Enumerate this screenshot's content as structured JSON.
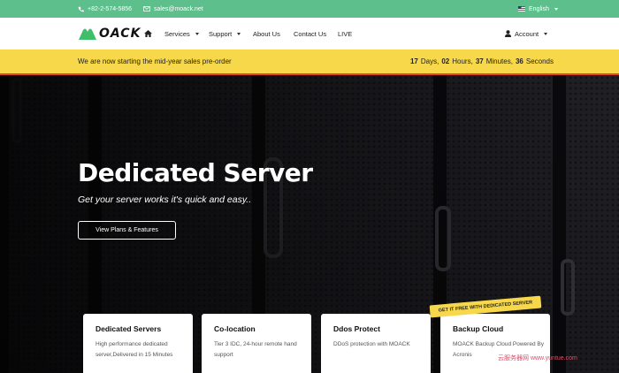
{
  "topbar": {
    "phone": "+82-2-574-5856",
    "email": "sales@moack.net",
    "language": "English"
  },
  "navbar": {
    "logo_text": "OACK",
    "items": [
      "Services",
      "Support",
      "About Us",
      "Contact Us",
      "LIVE"
    ],
    "account": "Account"
  },
  "promo": {
    "text": "We are now starting the mid-year sales pre-order",
    "countdown": {
      "days_value": "17",
      "days_label": "Days,",
      "hours_value": "02",
      "hours_label": "Hours,",
      "minutes_value": "37",
      "minutes_label": "Minutes,",
      "seconds_value": "36",
      "seconds_label": "Seconds"
    }
  },
  "hero": {
    "title": "Dedicated Server",
    "subtitle": "Get your server works it's quick and easy..",
    "button": "View Plans & Features"
  },
  "cards": [
    {
      "title": "Dedicated Servers",
      "description": "High performance dedicated server,Delivered in 15 Minutes"
    },
    {
      "title": "Co-location",
      "description": "Tier 3 IDC, 24-hour remote hand support"
    },
    {
      "title": "Ddos Protect",
      "description": "DDoS protection with MOACK"
    },
    {
      "title": "Backup Cloud",
      "description": "MOACK Backup Cloud Powered By Acronis"
    }
  ],
  "ribbon": "GET IT FREE WITH DEDICATED SERVER",
  "watermark": "云服务器网 www.yuntue.com",
  "colors": {
    "topbar": "#5cbf8c",
    "promo": "#f7d84a",
    "promo_border": "#e8413a",
    "logo": "#3fbf6a"
  }
}
